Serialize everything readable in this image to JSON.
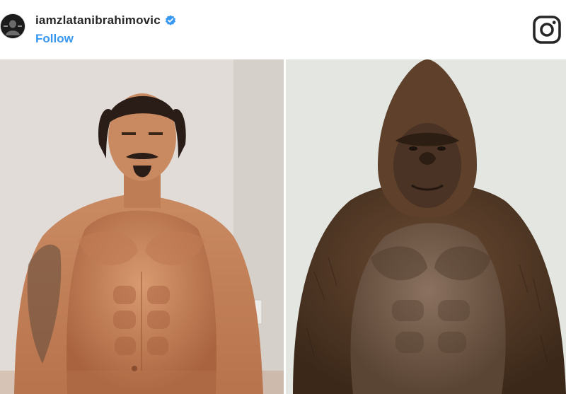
{
  "post": {
    "username": "iamzlatanibrahimovic",
    "follow_label": "Follow",
    "verified": true
  },
  "icons": {
    "avatar": "profile-avatar",
    "verified": "verified-badge-icon",
    "instagram": "instagram-logo-icon"
  },
  "colors": {
    "follow": "#3897f0",
    "verified": "#3897f0",
    "text": "#262626",
    "background": "#ffffff"
  },
  "images": [
    {
      "name": "man-photo",
      "subject": "shirtless man"
    },
    {
      "name": "gorilla-photo",
      "subject": "giant gorilla"
    }
  ]
}
